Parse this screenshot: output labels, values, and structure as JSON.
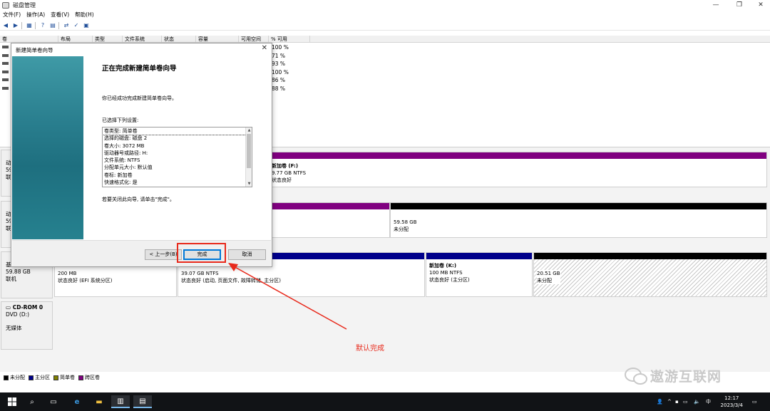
{
  "window": {
    "title": "磁盘管理"
  },
  "menu": [
    "文件(F)",
    "操作(A)",
    "查看(V)",
    "帮助(H)"
  ],
  "volume_table": {
    "columns": [
      "卷",
      "布局",
      "类型",
      "文件系统",
      "状态",
      "容量",
      "可用空间",
      "% 可用"
    ],
    "rows": [
      {
        "pct": "100 %"
      },
      {
        "pct": "71 %"
      },
      {
        "pct": "93 %"
      },
      {
        "pct": "100 %"
      },
      {
        "pct": "86 %"
      },
      {
        "pct": "88 %"
      }
    ]
  },
  "disks": {
    "disk0_partial": {
      "line1": "动",
      "line2": "59",
      "line3": "联"
    },
    "disk1_partial": {
      "line1": "动",
      "line2": "59",
      "line3": "联"
    },
    "disk2_partial": {
      "line1": "基",
      "line2": "59.88 GB",
      "line3": "联机"
    },
    "cdrom": {
      "name": "CD-ROM 0",
      "line2": "DVD (D:)",
      "line3": "无媒体"
    }
  },
  "partitions": {
    "f_volume": {
      "name": "新加卷 (F:)",
      "size": "9.77 GB NTFS",
      "status": "状态良好"
    },
    "unalloc_1": {
      "size": "59.58 GB",
      "status": "未分配"
    },
    "efi": {
      "size": "200 MB",
      "status": "状态良好 (EFI 系统分区)"
    },
    "c_volume": {
      "size": "39.07 GB NTFS",
      "status": "状态良好 (启动, 页面文件, 故障转储, 主分区)"
    },
    "k_volume": {
      "name": "新加卷 (K:)",
      "size": "100 MB NTFS",
      "status": "状态良好 (主分区)"
    },
    "unalloc_2": {
      "size": "20.51 GB",
      "status": "未分配"
    }
  },
  "legend": [
    {
      "label": "未分配",
      "color": "#000000"
    },
    {
      "label": "主分区",
      "color": "#00008b"
    },
    {
      "label": "简单卷",
      "color": "#808000"
    },
    {
      "label": "跨区卷",
      "color": "#800080"
    }
  ],
  "wizard": {
    "title": "新建简单卷向导",
    "heading": "正在完成新建简单卷向导",
    "body": "你已经成功完成新建简单卷向导。",
    "selected_label": "已选择下列设置:",
    "settings": [
      "卷类型: 简单卷",
      "选择的磁盘: 磁盘 2",
      "卷大小: 3072 MB",
      "驱动器号或路径: H:",
      "文件系统: NTFS",
      "分配单元大小: 默认值",
      "卷标: 新加卷",
      "快速格式化: 是"
    ],
    "close_hint": "若要关闭此向导, 请单击\"完成\"。",
    "buttons": {
      "back": "< 上一步(B)",
      "finish": "完成",
      "cancel": "取消"
    }
  },
  "annotation": {
    "note": "默认完成"
  },
  "watermark": {
    "text": "遨游互联网"
  },
  "taskbar": {
    "clock_time": "12:17",
    "clock_date": "2023/3/4",
    "ime": "中"
  },
  "colors": {
    "span_volume": "#800080",
    "primary_partition": "#00008b",
    "unallocated": "#000000",
    "highlight": "#e8291b"
  }
}
